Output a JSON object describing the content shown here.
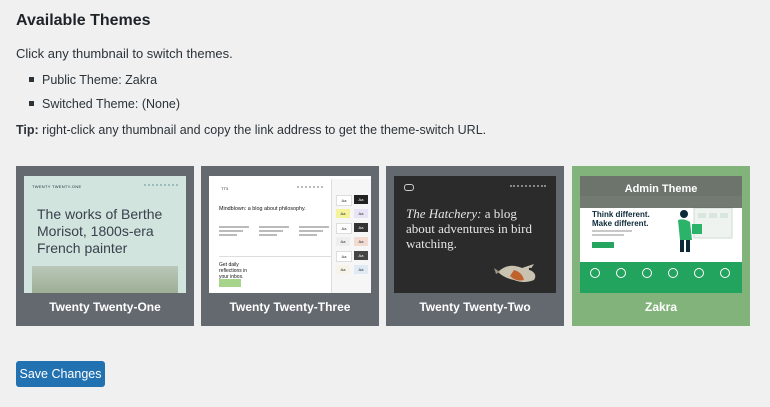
{
  "page": {
    "title": "Available Themes",
    "intro": "Click any thumbnail to switch themes.",
    "bullets": [
      "Public Theme: Zakra",
      "Switched Theme: (None)"
    ],
    "tip_label": "Tip:",
    "tip_text": " right-click any thumbnail and copy the link address to get the theme-switch URL."
  },
  "themes": [
    {
      "name": "Twenty Twenty-One",
      "preview": {
        "site_title": "TWENTY TWENTY-ONE",
        "headline": "The works of Berthe Morisot, 1800s-era French painter"
      }
    },
    {
      "name": "Twenty Twenty-Three",
      "preview": {
        "site_title": "TT3",
        "headline": "Mindblown: a blog about philosophy.",
        "cta": "Get daily reflections in your inbox.",
        "swatch_label": "Aa"
      }
    },
    {
      "name": "Twenty Twenty-Two",
      "preview": {
        "headline_em": "The Hatchery:",
        "headline_rest": " a blog about adventures in bird watching."
      }
    },
    {
      "name": "Zakra",
      "badge": "Admin Theme",
      "preview": {
        "headline": "Think different. Make different."
      }
    }
  ],
  "footer": {
    "save_label": "Save Changes"
  },
  "colors": {
    "accent": "#2271b1",
    "active_card": "#82b37a",
    "card": "#646970",
    "zakra_green": "#23a45e"
  }
}
